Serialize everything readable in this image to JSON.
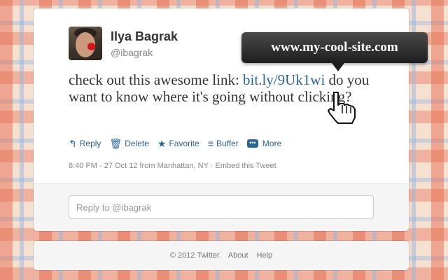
{
  "user": {
    "name": "Ilya Bagrak",
    "handle": "@ibagrak"
  },
  "tweet": {
    "text_before_link": "check out this awesome link: ",
    "link_text": "bit.ly/9Uk1wi",
    "text_after_link": " do you want to know where it's going without clicking?",
    "meta": "8:40 PM - 27 Oct 12 from Manhattan, NY · Embed this Tweet"
  },
  "actions": [
    {
      "label": "Reply",
      "icon": "reply-icon"
    },
    {
      "label": "Delete",
      "icon": "trash-icon"
    },
    {
      "label": "Favorite",
      "icon": "star-icon"
    },
    {
      "label": "Buffer",
      "icon": "buffer-icon"
    },
    {
      "label": "More",
      "icon": "more-icon"
    }
  ],
  "reply": {
    "placeholder": "Reply to @ibagrak"
  },
  "footer": {
    "copyright": "© 2012 Twitter",
    "about": "About",
    "help": "Help"
  },
  "tooltip": {
    "text": "www.my-cool-site.com"
  },
  "colors": {
    "link": "#2a6496",
    "tooltip_bg": "#2b2b2b",
    "text": "#333333",
    "muted": "#888888"
  }
}
